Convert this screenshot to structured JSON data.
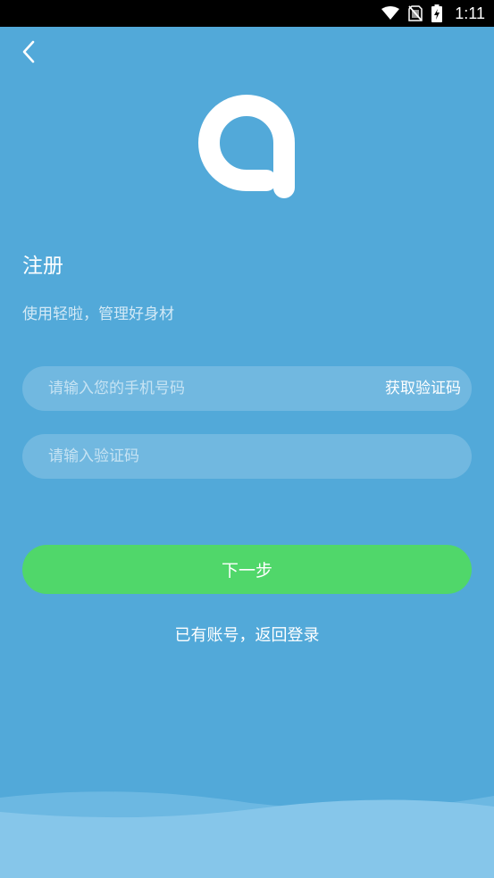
{
  "status_bar": {
    "time": "1:11",
    "icons": [
      "wifi-icon",
      "no-sim-icon",
      "battery-charging-icon"
    ]
  },
  "header": {
    "back_icon": "chevron-left-icon"
  },
  "logo": {
    "icon": "app-logo-a"
  },
  "register": {
    "title": "注册",
    "subtitle": "使用轻啦，管理好身材",
    "phone_placeholder": "请输入您的手机号码",
    "phone_value": "",
    "get_code_label": "获取验证码",
    "code_placeholder": "请输入验证码",
    "code_value": "",
    "next_label": "下一步",
    "login_link": "已有账号，返回登录"
  },
  "colors": {
    "background": "#52a9d9",
    "button_green": "#50d76a",
    "status_bar": "#000000",
    "wave_light": "#7cc0e6"
  }
}
